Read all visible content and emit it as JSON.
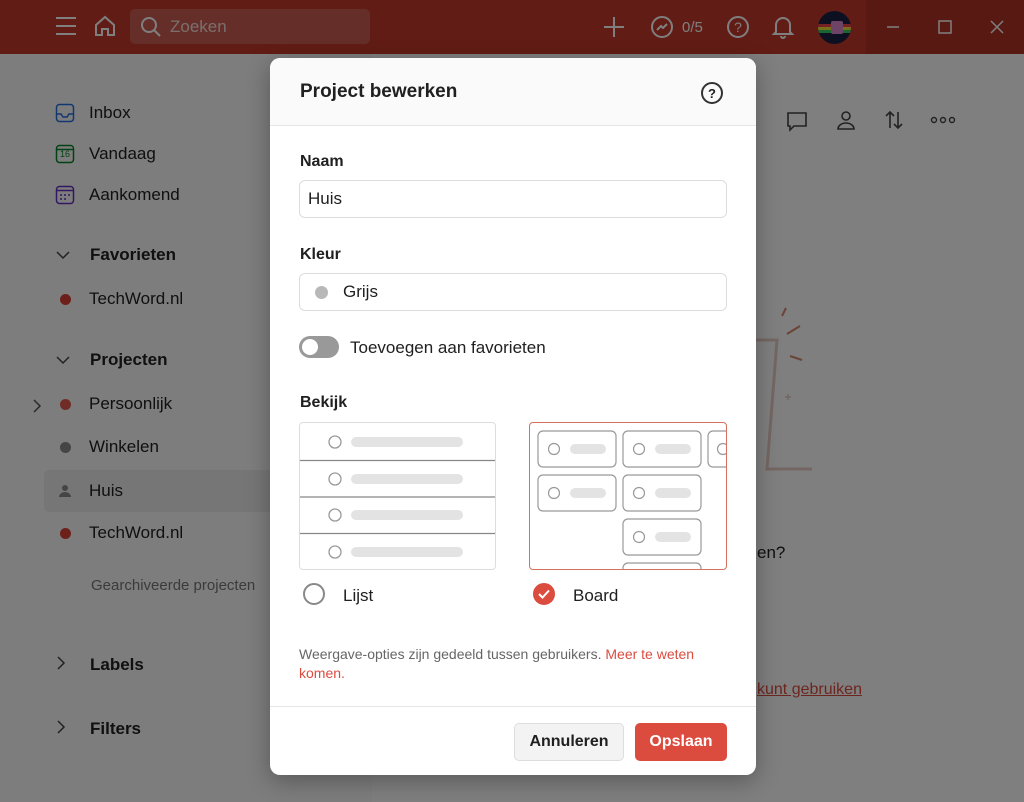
{
  "topbar": {
    "search_placeholder": "Zoeken",
    "karma": "0/5"
  },
  "sidebar": {
    "inbox": "Inbox",
    "today": "Vandaag",
    "today_day": "16",
    "upcoming": "Aankomend",
    "favorites_heading": "Favorieten",
    "favorites": [
      {
        "label": "TechWord.nl",
        "color": "#db4035"
      }
    ],
    "projects_heading": "Projecten",
    "projects": [
      {
        "label": "Persoonlijk",
        "color": "#e05a4f"
      },
      {
        "label": "Winkelen",
        "color": "#8a8a8a"
      },
      {
        "label": "Huis",
        "color": "#8a8a8a"
      },
      {
        "label": "TechWord.nl",
        "color": "#db4035"
      }
    ],
    "archived": "Gearchiveerde projecten",
    "labels_heading": "Labels",
    "filters_heading": "Filters"
  },
  "main": {
    "partial_text_1": "en?",
    "partial_link": "kunt gebruiken"
  },
  "modal": {
    "title": "Project bewerken",
    "name_label": "Naam",
    "name_value": "Huis",
    "color_label": "Kleur",
    "color_value": "Grijs",
    "favorite_toggle_label": "Toevoegen aan favorieten",
    "favorite_on": false,
    "view_label": "Bekijk",
    "view_list": "Lijst",
    "view_board": "Board",
    "selected_view": "Board",
    "note_text": "Weergave-opties zijn gedeeld tussen gebruikers.",
    "note_link": "Meer te weten komen.",
    "cancel": "Annuleren",
    "save": "Opslaan"
  },
  "colors": {
    "accent": "#db4c3f",
    "topbar": "#c3392b",
    "grey": "#b8b8b8"
  }
}
